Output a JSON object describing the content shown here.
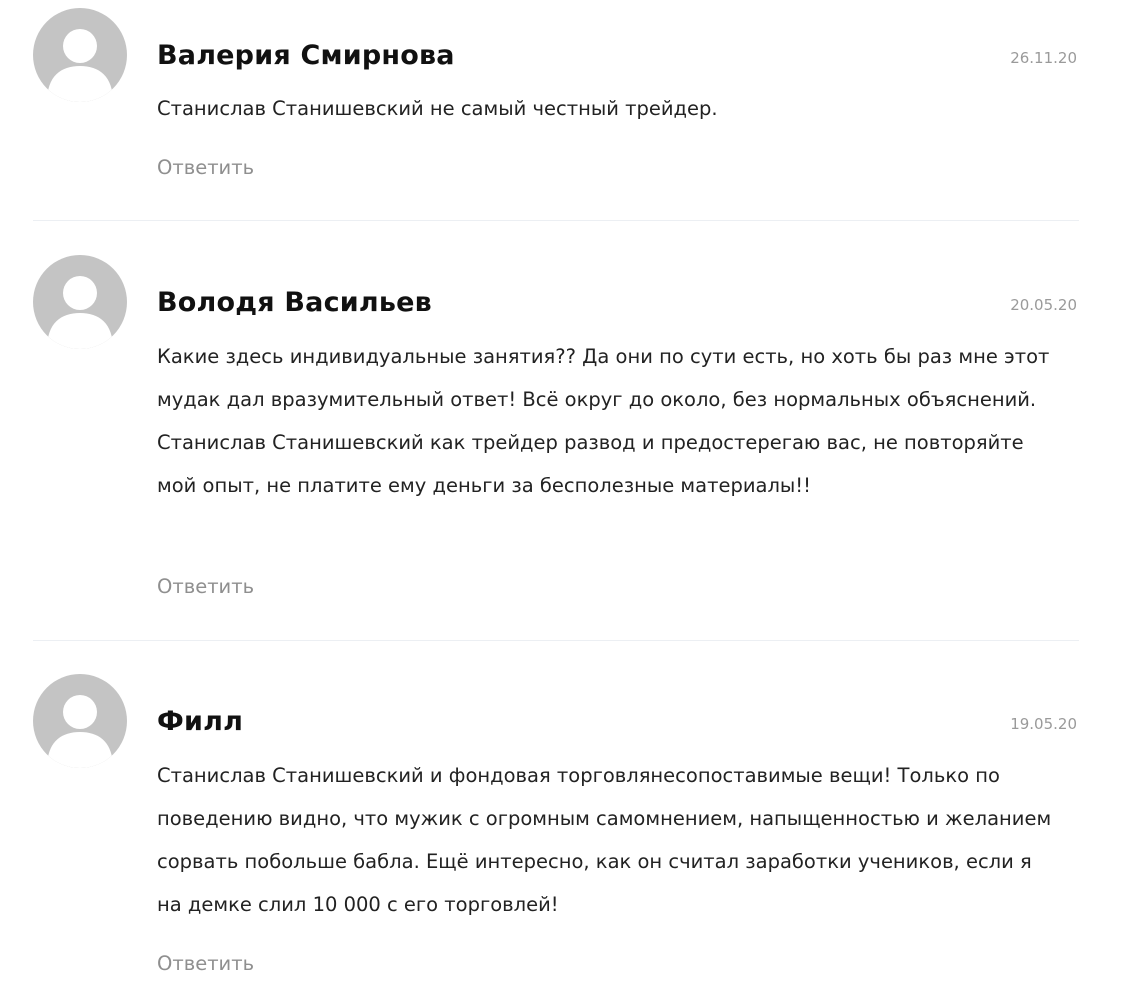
{
  "comments": [
    {
      "author": "Валерия Смирнова",
      "date": "26.11.20",
      "text": "Станислав Станишевский не самый честный трейдер.",
      "reply_label": "Ответить"
    },
    {
      "author": "Володя Васильев",
      "date": "20.05.20",
      "text": "Какие здесь индивидуальные занятия?? Да они по сути есть, но хоть бы раз мне этот мудак дал вразумительный ответ! Всё округ до около, без нормальных объяснений. Станислав Станишевский как трейдер развод и предостерегаю вас, не повторяйте мой опыт, не платите ему деньги за бесполезные материалы!!",
      "reply_label": "Ответить"
    },
    {
      "author": "Филл",
      "date": "19.05.20",
      "text": "Станислав Станишевский и фондовая торговлянесопоставимые вещи! Только по поведению видно, что мужик с огромным самомнением, напыщенностью и желанием сорвать побольше бабла. Ещё интересно, как он считал заработки учеников, если я на демке слил 10 000 с его торговлей!",
      "reply_label": "Ответить"
    }
  ],
  "icons": {
    "avatar": "user-placeholder-icon"
  },
  "colors": {
    "avatar_bg": "#c4c4c4",
    "avatar_fg": "#ffffff",
    "date": "#9a9a9a",
    "reply": "#8f8f8f",
    "divider": "#eceff3"
  }
}
